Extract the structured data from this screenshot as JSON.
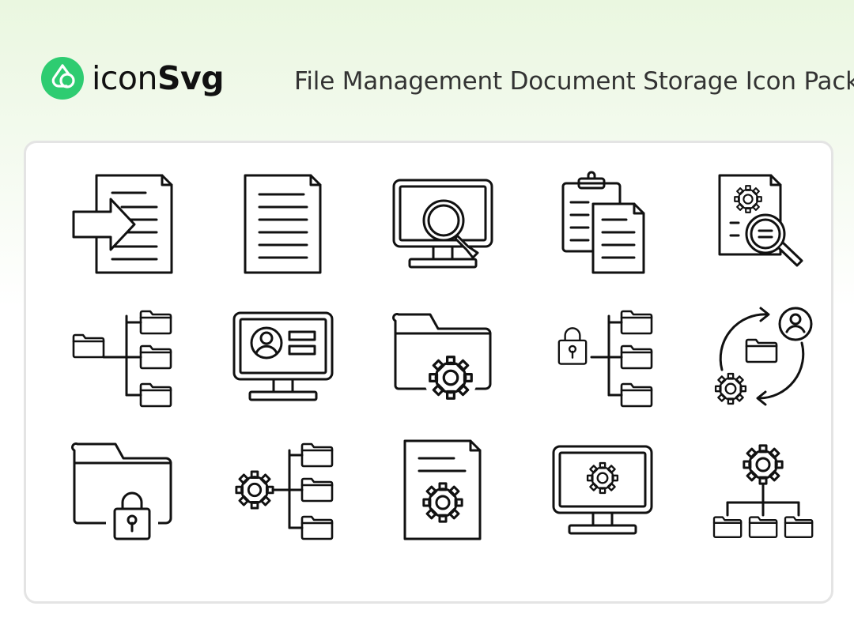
{
  "brand": {
    "name_part1": "icon",
    "name_part2": "Svg",
    "logo_icon": "iconsvg-logo-icon",
    "accent_color": "#2ecc71"
  },
  "header": {
    "title": "File Management Document Storage Icon Pack"
  },
  "icons": [
    [
      "import-document-icon",
      "document-icon",
      "monitor-search-icon",
      "clipboard-copy-icon",
      "document-settings-search-icon"
    ],
    [
      "folder-tree-icon",
      "monitor-profile-icon",
      "folder-settings-icon",
      "locked-folder-tree-icon",
      "folder-sync-user-icon"
    ],
    [
      "locked-folder-icon",
      "settings-folder-tree-icon",
      "document-settings-icon",
      "monitor-settings-icon",
      "settings-hierarchy-folders-icon"
    ]
  ],
  "colors": {
    "icon_stroke": "#111111",
    "card_border": "#e4e4e4",
    "background_top": "#eaf7e0"
  }
}
